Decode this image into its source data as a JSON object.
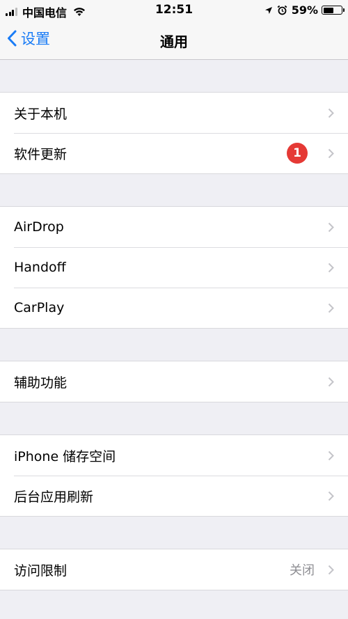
{
  "status_bar": {
    "carrier": "中国电信",
    "time": "12:51",
    "battery_percent": "59%",
    "battery_level": 0.59,
    "icons": [
      "signal-icon",
      "wifi-icon",
      "location-arrow-icon",
      "alarm-icon",
      "battery-icon"
    ]
  },
  "nav": {
    "back_label": "设置",
    "title": "通用"
  },
  "groups": [
    {
      "rows": [
        {
          "label": "关于本机"
        },
        {
          "label": "软件更新",
          "badge": "1"
        }
      ]
    },
    {
      "rows": [
        {
          "label": "AirDrop"
        },
        {
          "label": "Handoff"
        },
        {
          "label": "CarPlay"
        }
      ]
    },
    {
      "rows": [
        {
          "label": "辅助功能"
        }
      ]
    },
    {
      "rows": [
        {
          "label": "iPhone 储存空间"
        },
        {
          "label": "后台应用刷新"
        }
      ]
    },
    {
      "rows": [
        {
          "label": "访问限制",
          "value": "关闭"
        }
      ]
    }
  ],
  "colors": {
    "accent": "#1a7cf6",
    "badge": "#e53935",
    "background": "#efeff4"
  }
}
